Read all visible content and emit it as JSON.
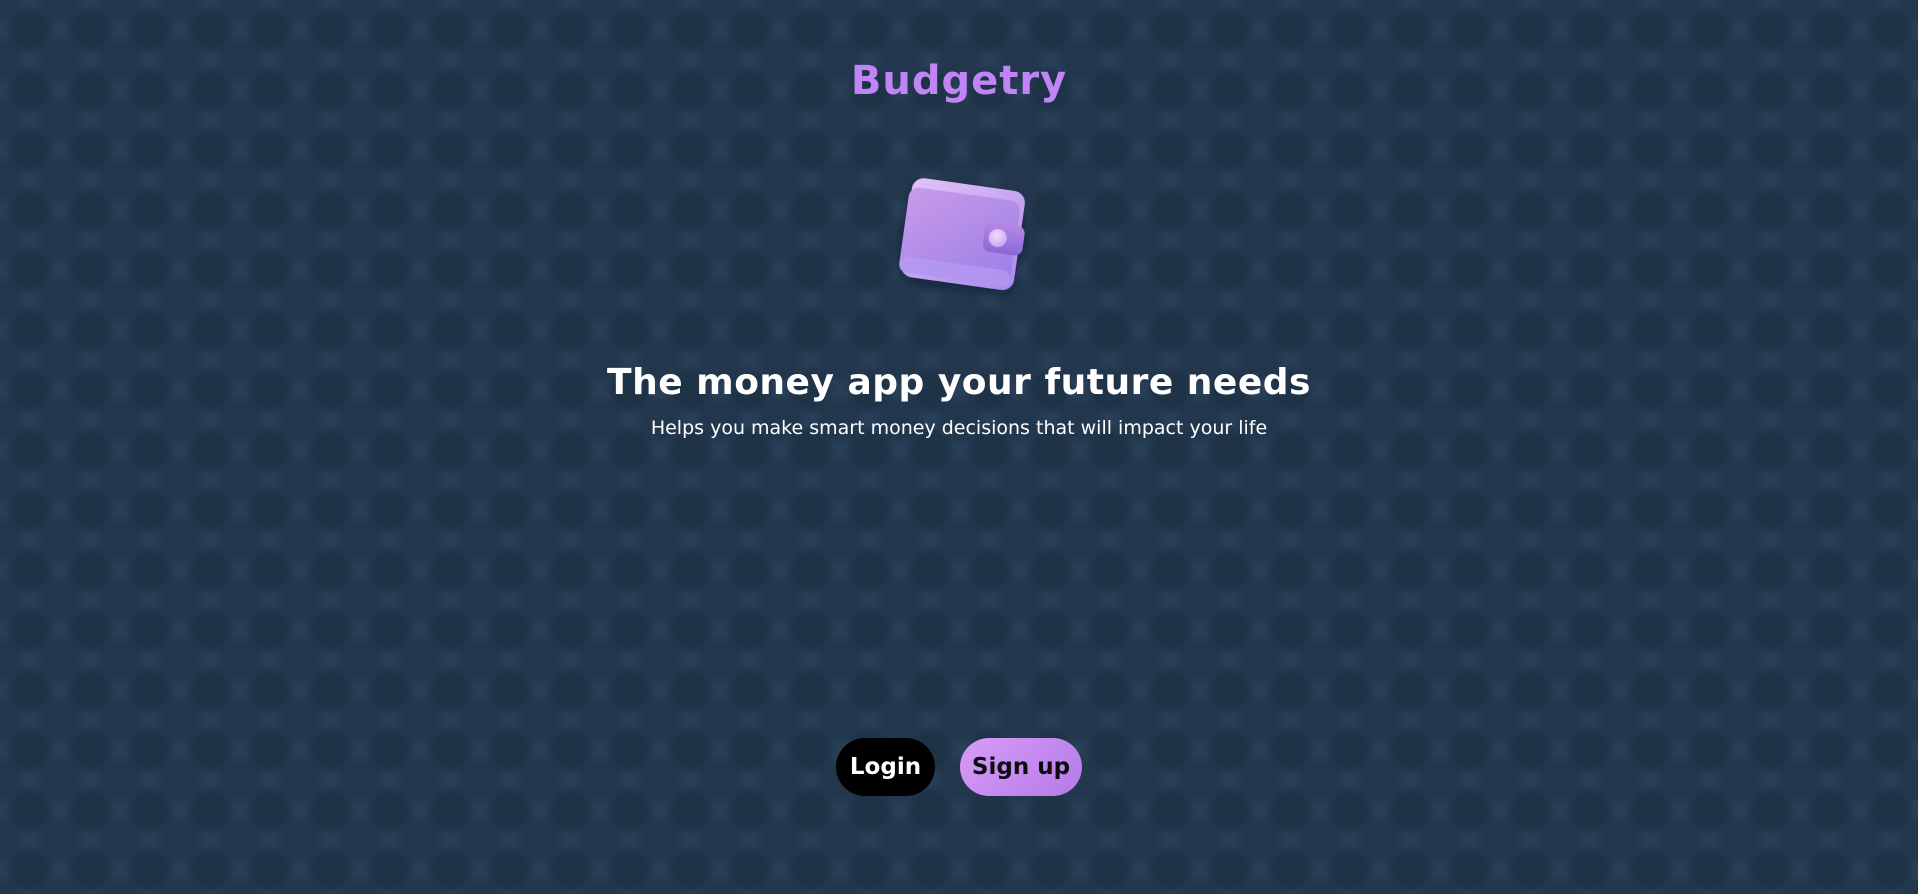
{
  "app": {
    "name": "Budgetry"
  },
  "hero": {
    "image_icon": "wallet-icon",
    "headline": "The money app your future needs",
    "subtitle": "Helps you make smart money decisions that will impact your life"
  },
  "actions": {
    "login_label": "Login",
    "signup_label": "Sign up"
  },
  "colors": {
    "background": "#283f57",
    "brand": "#c084f5",
    "login_button": "#000000",
    "signup_button": "#c58af0",
    "text": "#ffffff"
  }
}
